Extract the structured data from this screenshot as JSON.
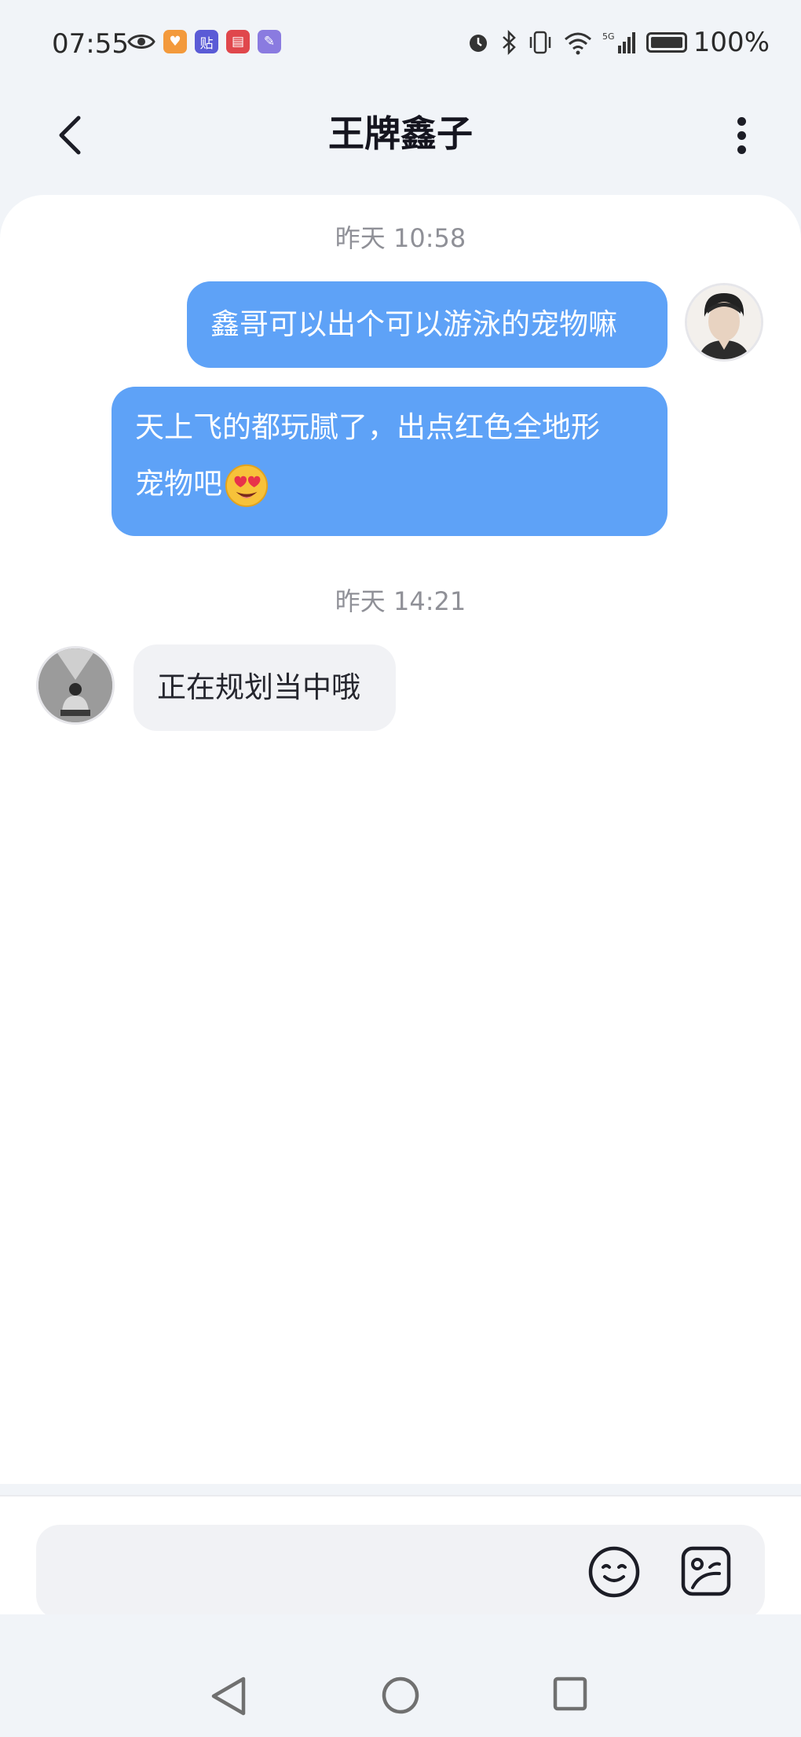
{
  "status_bar": {
    "time": "07:55",
    "left_icons": [
      "eye-icon",
      "app-icon-orange",
      "app-icon-tieba",
      "app-icon-book",
      "app-icon-bird"
    ],
    "right_icons": [
      "alarm-icon",
      "bluetooth-icon",
      "vibrate-icon",
      "wifi-icon",
      "signal-icon"
    ],
    "battery_percent": "100%",
    "battery_level": 1.0
  },
  "header": {
    "title": "王牌鑫子",
    "back_icon": "chevron-left-icon",
    "more_icon": "more-vertical-icon"
  },
  "messages": [
    {
      "type": "timestamp",
      "text": "昨天 10:58"
    },
    {
      "type": "outgoing",
      "text": "鑫哥可以出个可以游泳的宠物嘛"
    },
    {
      "type": "outgoing",
      "line1": "天上飞的都玩腻了，出点红色全地形",
      "line2": "宠物吧",
      "emoji": "heart-eyes-emoji-icon"
    },
    {
      "type": "timestamp",
      "text": "昨天 14:21"
    },
    {
      "type": "incoming",
      "text": "正在规划当中哦"
    }
  ],
  "input": {
    "placeholder": "",
    "emoji_icon": "smile-icon",
    "sticker_icon": "sticker-icon"
  },
  "nav": {
    "back_icon": "triangle-back-icon",
    "home_icon": "circle-home-icon",
    "recent_icon": "square-recent-icon"
  },
  "colors": {
    "outgoing_bubble": "#5ea2f7",
    "incoming_bubble": "#f1f2f5",
    "background": "#f1f4f8"
  }
}
